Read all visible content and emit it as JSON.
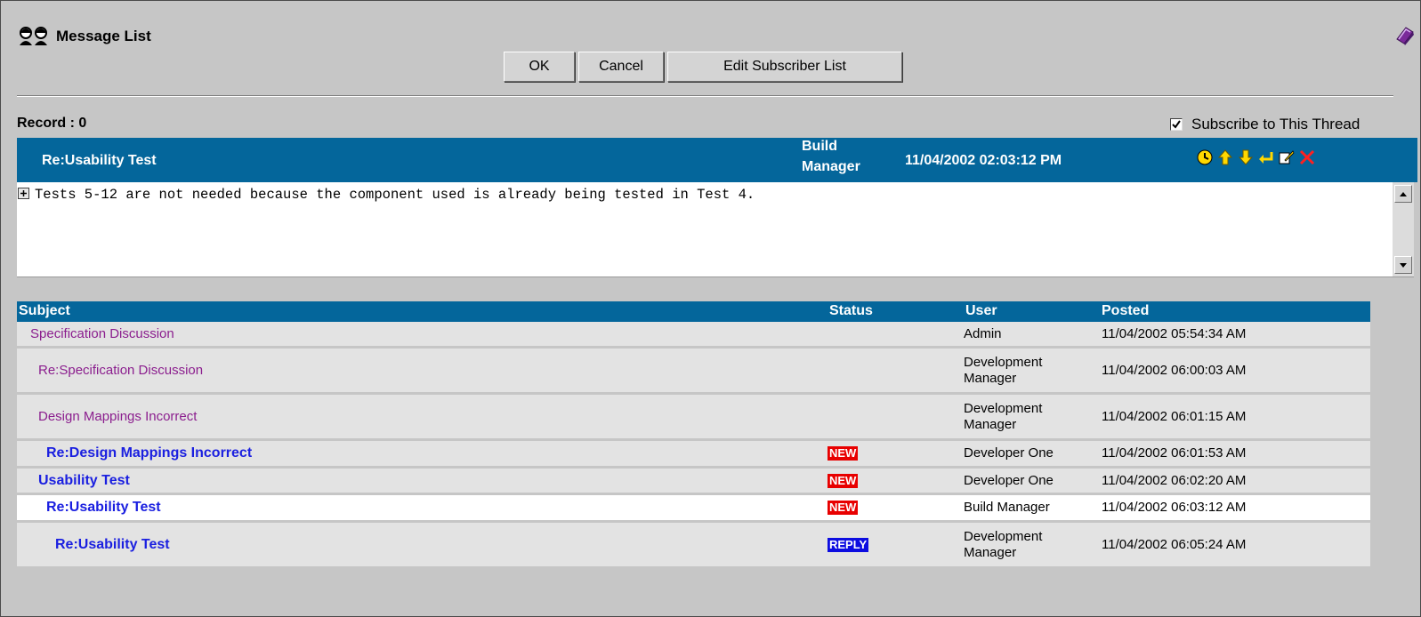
{
  "window": {
    "title": "Message List"
  },
  "buttons": {
    "ok": "OK",
    "cancel": "Cancel",
    "edit_subscribers": "Edit Subscriber List"
  },
  "record": {
    "label": "Record : 0"
  },
  "subscribe": {
    "label": "Subscribe to This Thread",
    "checked": true
  },
  "message": {
    "subject": "Re:Usability Test",
    "user_line1": "Build",
    "user_line2": "Manager",
    "posted": "11/04/2002 02:03:12 PM",
    "body": "Tests 5-12 are not needed because the component used is already being tested in Test 4.",
    "tools": [
      "clock-icon",
      "arrow-up-icon",
      "arrow-down-icon",
      "reply-icon",
      "edit-icon",
      "delete-icon"
    ]
  },
  "table": {
    "columns": {
      "subject": "Subject",
      "status": "Status",
      "user": "User",
      "posted": "Posted"
    },
    "rows": [
      {
        "subject": "Specification Discussion",
        "indent": 0,
        "style": "muted",
        "status": "",
        "user": "Admin",
        "posted": "11/04/2002 05:54:34 AM"
      },
      {
        "subject": "Re:Specification Discussion",
        "indent": 1,
        "style": "muted",
        "status": "",
        "user": "Development Manager",
        "user_l1": "Development",
        "user_l2": "Manager",
        "posted": "11/04/2002 06:00:03 AM"
      },
      {
        "subject": "Design Mappings Incorrect",
        "indent": 1,
        "style": "muted",
        "status": "",
        "user": "Development Manager",
        "user_l1": "Development",
        "user_l2": "Manager",
        "posted": "11/04/2002 06:01:15 AM"
      },
      {
        "subject": "Re:Design Mappings Incorrect",
        "indent": 2,
        "style": "bold",
        "status": "NEW",
        "user": "Developer One",
        "posted": "11/04/2002 06:01:53 AM"
      },
      {
        "subject": "Usability Test",
        "indent": 1,
        "style": "bold",
        "status": "NEW",
        "user": "Developer One",
        "posted": "11/04/2002 06:02:20 AM"
      },
      {
        "subject": "Re:Usability Test",
        "indent": 2,
        "style": "bold",
        "status": "NEW",
        "user": "Build Manager",
        "posted": "11/04/2002 06:03:12 AM",
        "selected": true
      },
      {
        "subject": "Re:Usability Test",
        "indent": 3,
        "style": "bold",
        "status": "REPLY",
        "user": "Development Manager",
        "user_l1": "Development",
        "user_l2": "Manager",
        "posted": "11/04/2002 06:05:24 AM"
      }
    ]
  },
  "colors": {
    "header_blue": "#04669b",
    "badge_new": "#e80000",
    "badge_reply": "#0d0de0",
    "subject_muted": "#8b1e8e",
    "subject_bold": "#1a1fe0"
  }
}
